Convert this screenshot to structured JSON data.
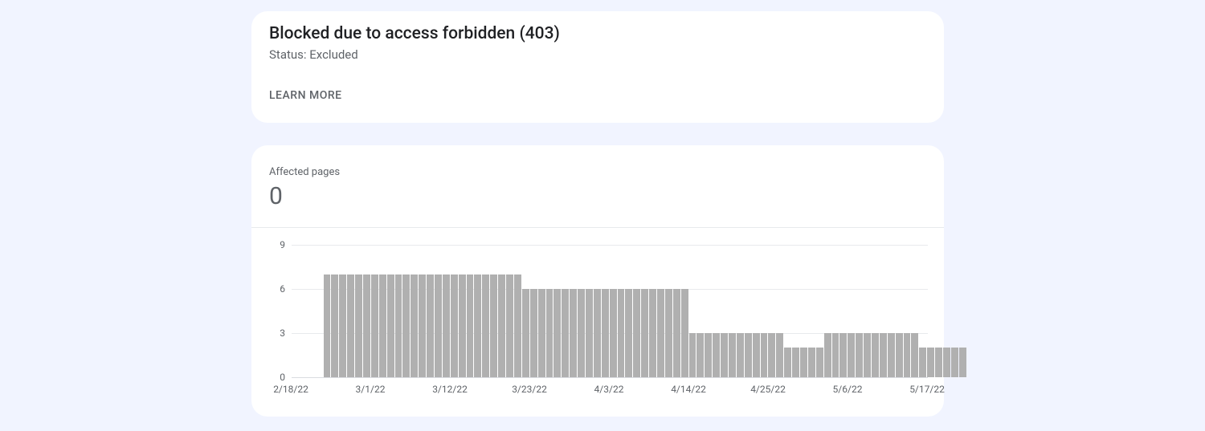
{
  "header": {
    "title": "Blocked due to access forbidden (403)",
    "status": "Status: Excluded",
    "learn_more": "LEARN MORE"
  },
  "metric": {
    "label": "Affected pages",
    "value": "0"
  },
  "chart_data": {
    "type": "bar",
    "title": "",
    "xlabel": "",
    "ylabel": "",
    "ylim": [
      0,
      9
    ],
    "yticks": [
      0,
      3,
      6,
      9
    ],
    "xtick_labels": [
      "2/18/22",
      "3/1/22",
      "3/12/22",
      "3/23/22",
      "4/3/22",
      "4/14/22",
      "4/25/22",
      "5/6/22",
      "5/17/22"
    ],
    "categories": [
      "2/22/22",
      "2/23/22",
      "2/24/22",
      "2/25/22",
      "2/26/22",
      "2/27/22",
      "2/28/22",
      "3/1/22",
      "3/2/22",
      "3/3/22",
      "3/4/22",
      "3/5/22",
      "3/6/22",
      "3/7/22",
      "3/8/22",
      "3/9/22",
      "3/10/22",
      "3/11/22",
      "3/12/22",
      "3/13/22",
      "3/14/22",
      "3/15/22",
      "3/16/22",
      "3/17/22",
      "3/18/22",
      "3/19/22",
      "3/20/22",
      "3/21/22",
      "3/22/22",
      "3/23/22",
      "3/24/22",
      "3/25/22",
      "3/26/22",
      "3/27/22",
      "3/28/22",
      "3/29/22",
      "3/30/22",
      "3/31/22",
      "4/1/22",
      "4/2/22",
      "4/3/22",
      "4/4/22",
      "4/5/22",
      "4/6/22",
      "4/7/22",
      "4/8/22",
      "4/9/22",
      "4/10/22",
      "4/11/22",
      "4/12/22",
      "4/13/22",
      "4/14/22",
      "4/15/22",
      "4/16/22",
      "4/17/22",
      "4/18/22",
      "4/19/22",
      "4/20/22",
      "4/21/22",
      "4/22/22",
      "4/23/22",
      "4/24/22",
      "4/25/22",
      "4/26/22",
      "4/27/22",
      "4/28/22",
      "4/29/22",
      "4/30/22",
      "5/1/22",
      "5/2/22",
      "5/3/22",
      "5/4/22",
      "5/5/22",
      "5/6/22",
      "5/7/22",
      "5/8/22",
      "5/9/22",
      "5/10/22",
      "5/11/22",
      "5/12/22",
      "5/13/22"
    ],
    "values": [
      7,
      7,
      7,
      7,
      7,
      7,
      7,
      7,
      7,
      7,
      7,
      7,
      7,
      7,
      7,
      7,
      7,
      7,
      7,
      7,
      7,
      7,
      7,
      7,
      7,
      6,
      6,
      6,
      6,
      6,
      6,
      6,
      6,
      6,
      6,
      6,
      6,
      6,
      6,
      6,
      6,
      6,
      6,
      6,
      6,
      6,
      3,
      3,
      3,
      3,
      3,
      3,
      3,
      3,
      3,
      3,
      3,
      3,
      2,
      2,
      2,
      2,
      2,
      3,
      3,
      3,
      3,
      3,
      3,
      3,
      3,
      3,
      3,
      3,
      3,
      2,
      2,
      2,
      2,
      2,
      2
    ],
    "leading_empty_slots": 4,
    "total_slots": 89
  }
}
